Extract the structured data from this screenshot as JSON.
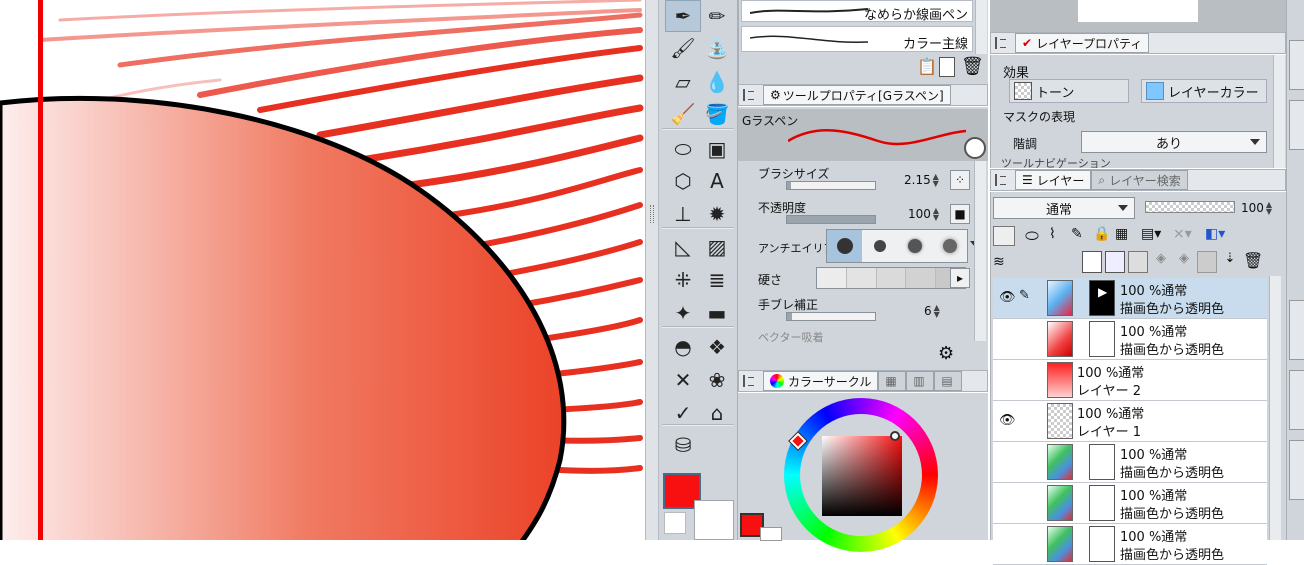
{
  "colors": {
    "main_color": "#f81010",
    "sub_color": "#ffffff",
    "panel_bg": "#cfd5db",
    "selected_layer": "#c9dced",
    "brush_stroke": "#e83020",
    "sun_gradient_start": "#fdeeee",
    "sun_gradient_end": "#eb4328"
  },
  "toolbar": {
    "tools": [
      {
        "name": "pen-tool-icon",
        "glyph": "✒",
        "selected": true
      },
      {
        "name": "pencil-tool-icon",
        "glyph": "✏",
        "selected": false
      },
      {
        "name": "brush-tool-icon",
        "glyph": "🖌",
        "selected": false
      },
      {
        "name": "airbrush-tool-icon",
        "glyph": "⛲",
        "selected": false
      },
      {
        "name": "eraser-tool-icon",
        "glyph": "▱",
        "selected": false
      },
      {
        "name": "blend-tool-icon",
        "glyph": "💧",
        "selected": false
      },
      {
        "name": "decoration-tool-icon",
        "glyph": "🧹",
        "selected": false
      },
      {
        "name": "fill-tool-icon",
        "glyph": "🪣",
        "selected": false
      },
      {
        "name": "lasso-fill-tool-icon",
        "glyph": "⬭",
        "selected": false
      },
      {
        "name": "gradient-tool-icon",
        "glyph": "▣",
        "selected": false
      },
      {
        "name": "figure-tool-icon",
        "glyph": "⬡",
        "selected": false
      },
      {
        "name": "text-tool-icon",
        "glyph": "A",
        "selected": false
      },
      {
        "name": "balloon-tool-icon",
        "glyph": "⊥",
        "selected": false
      },
      {
        "name": "effect-line-tool-icon",
        "glyph": "✹",
        "selected": false
      },
      {
        "name": "ruler-tool-icon",
        "glyph": "◺",
        "selected": false
      },
      {
        "name": "frame-tool-icon",
        "glyph": "▨",
        "selected": false
      },
      {
        "name": "speed-line-tool-icon",
        "glyph": "⁜",
        "selected": false
      },
      {
        "name": "hatch-tool-icon",
        "glyph": "≣",
        "selected": false
      },
      {
        "name": "sparkle-tool-icon",
        "glyph": "✦",
        "selected": false
      },
      {
        "name": "banner-tool-icon",
        "glyph": "▬",
        "selected": false
      },
      {
        "name": "hat-tool-icon",
        "glyph": "◓",
        "selected": false
      },
      {
        "name": "pattern-tool-icon",
        "glyph": "❖",
        "selected": false
      },
      {
        "name": "cross-tool-icon",
        "glyph": "✕",
        "selected": false
      },
      {
        "name": "flower-tool-icon",
        "glyph": "❀",
        "selected": false
      },
      {
        "name": "bird-tool-icon",
        "glyph": "✓",
        "selected": false
      },
      {
        "name": "house-tool-icon",
        "glyph": "⌂",
        "selected": false
      },
      {
        "name": "pot-tool-icon",
        "glyph": "⛁",
        "selected": false
      }
    ]
  },
  "subtool": {
    "items": [
      {
        "label": "なめらか線画ペン"
      },
      {
        "label": "カラー主線"
      }
    ]
  },
  "tool_property": {
    "tab_label": "ツールプロパティ[Gラスペン]",
    "brush_name": "Gラスペン",
    "brush_size_label": "ブラシサイズ",
    "brush_size_value": "2.15",
    "brush_size_fraction": 0.05,
    "opacity_label": "不透明度",
    "opacity_value": "100",
    "opacity_fraction": 1.0,
    "antialias_label": "アンチエイリアス",
    "hardness_label": "硬さ",
    "stabilization_label": "手ブレ補正",
    "stabilization_value": "6",
    "vector_label": "ベクター吸着"
  },
  "color_circle": {
    "tab_label": "カラーサークル"
  },
  "layer_property": {
    "tab_label": "レイヤープロパティ",
    "effect_label": "効果",
    "tone_label": "トーン",
    "layer_color_label": "レイヤーカラー",
    "mask_label": "マスクの表現",
    "gradation_label": "階調",
    "gradation_value": "あり",
    "truncated_label": "ツールナビゲーション"
  },
  "layers_panel": {
    "tab_label": "レイヤー",
    "search_tab_label": "レイヤー検索",
    "blend_mode": "通常",
    "opacity_value": "100",
    "layers": [
      {
        "line1": "100 %通常",
        "line2": "描画色から透明色",
        "visible": true,
        "editing": true,
        "has_mask": true,
        "selected": true,
        "thumb": "gradient-blue"
      },
      {
        "line1": "100 %通常",
        "line2": "描画色から透明色",
        "visible": false,
        "editing": false,
        "has_mask": true,
        "selected": false,
        "thumb": "gradient-red"
      },
      {
        "line1": "100 %通常",
        "line2": "レイヤー 2",
        "visible": false,
        "editing": false,
        "has_mask": false,
        "selected": false,
        "thumb": "red"
      },
      {
        "line1": "100 %通常",
        "line2": "レイヤー 1",
        "visible": true,
        "editing": false,
        "has_mask": false,
        "selected": false,
        "thumb": "checker"
      },
      {
        "line1": "100 %通常",
        "line2": "描画色から透明色",
        "visible": false,
        "editing": false,
        "has_mask": true,
        "selected": false,
        "thumb": "gradient-green"
      },
      {
        "line1": "100 %通常",
        "line2": "描画色から透明色",
        "visible": false,
        "editing": false,
        "has_mask": true,
        "selected": false,
        "thumb": "gradient-green"
      },
      {
        "line1": "100 %通常",
        "line2": "描画色から透明色",
        "visible": false,
        "editing": false,
        "has_mask": true,
        "selected": false,
        "thumb": "gradient-green"
      }
    ]
  }
}
